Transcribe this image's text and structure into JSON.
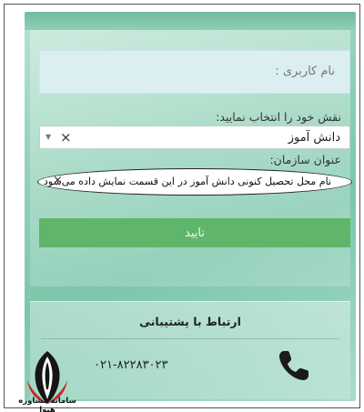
{
  "form": {
    "username_placeholder": "نام کاربری :",
    "role_label": "نقش خود را انتخاب نمایید:",
    "role_value": "دانش آموز",
    "role_clear": "×",
    "org_label": "عنوان سازمان:",
    "org_value": "نام محل تحصیل کنونی دانش آموز در این قسمت نمایش داده می‌شود",
    "org_clear": "×",
    "submit_label": "تایید"
  },
  "support": {
    "title": "ارتباط با پشتیبانی",
    "phone": "۰۲۱-۸۲۲۸۳۰۲۳"
  },
  "logo": {
    "text": "سامانه مشاوره هیوا"
  },
  "icons": {
    "phone": "phone-icon",
    "dropdown": "chevron-down-icon",
    "clear": "close-icon"
  },
  "colors": {
    "panel": "#8fd0b6",
    "submit": "#5fb569",
    "username_field": "#dbeff3"
  }
}
